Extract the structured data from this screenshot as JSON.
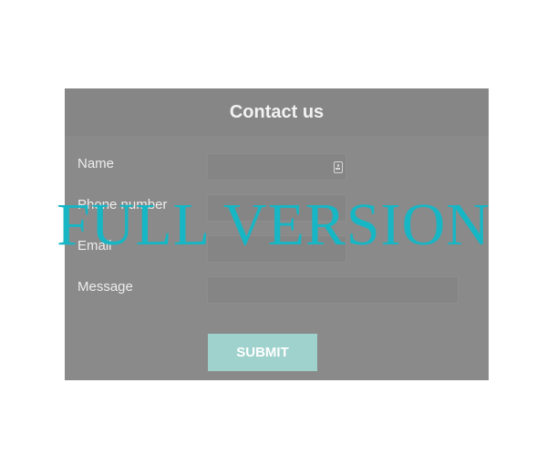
{
  "form": {
    "title": "Contact us",
    "fields": [
      {
        "label": "Name",
        "value": ""
      },
      {
        "label": "Phone number",
        "value": ""
      },
      {
        "label": "Email",
        "value": ""
      },
      {
        "label": "Message",
        "value": ""
      }
    ],
    "name_icon": "contact-card-icon",
    "submit_label": "SUBMIT"
  },
  "watermark": {
    "text": "FULL VERSION"
  },
  "colors": {
    "panel": "#8a8a8a",
    "input": "#858585",
    "submit": "#9fd2cc",
    "watermark": "#17b6c4"
  }
}
